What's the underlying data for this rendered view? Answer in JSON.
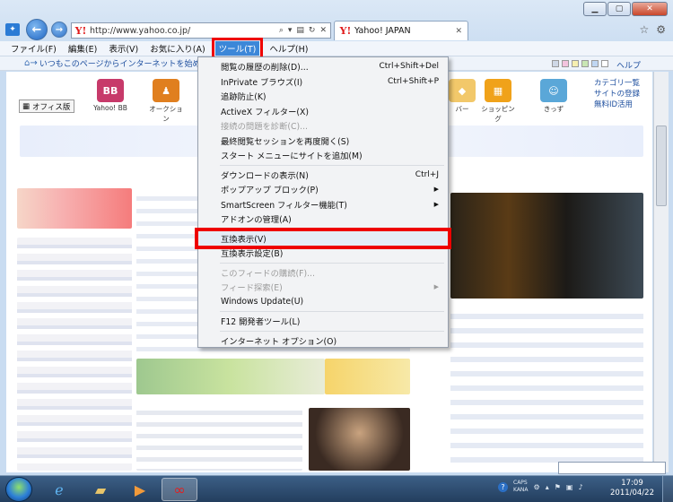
{
  "window": {
    "address": "http://www.yahoo.co.jp/",
    "tab_title": "Yahoo! JAPAN",
    "favicon_letter": "Y!"
  },
  "menubar": [
    "ファイル(F)",
    "編集(E)",
    "表示(V)",
    "お気に入り(A)",
    "ツール(T)",
    "ヘルプ(H)"
  ],
  "menubar_active_index": 4,
  "cmdbar": {
    "homepage_link": "いつもこのページからインターネットを始める",
    "help_link": "ヘルプ",
    "swatch_colors": [
      "#cfd8e6",
      "#f3c3de",
      "#f6efb0",
      "#c9e6b4",
      "#bfd6f2",
      "#ffffff"
    ]
  },
  "page": {
    "office_button": "オフィス版",
    "services": [
      {
        "label": "Yahoo! BB",
        "tile": "BB",
        "color": "#c73a6a"
      },
      {
        "label": "オークション",
        "tile": "♟",
        "color": "#e07f1f"
      },
      {
        "label": "ショッピング",
        "tile": "▦",
        "color": "#f0a21a"
      },
      {
        "label": "きっず",
        "tile": "☺",
        "color": "#5aa7d8"
      }
    ],
    "partial_service_label": "バー",
    "right_links": [
      "カテゴリ一覧",
      "サイトの登録",
      "無料ID活用"
    ]
  },
  "tools_menu": {
    "items": [
      {
        "label": "閲覧の履歴の削除(D)...",
        "shortcut": "Ctrl+Shift+Del",
        "disabled": false
      },
      {
        "label": "InPrivate ブラウズ(I)",
        "shortcut": "Ctrl+Shift+P",
        "disabled": false
      },
      {
        "label": "追跡防止(K)",
        "shortcut": "",
        "disabled": false
      },
      {
        "label": "ActiveX フィルター(X)",
        "shortcut": "",
        "disabled": false
      },
      {
        "label": "接続の問題を診断(C)...",
        "shortcut": "",
        "disabled": true
      },
      {
        "label": "最終閲覧セッションを再度開く(S)",
        "shortcut": "",
        "disabled": false
      },
      {
        "label": "スタート メニューにサイトを追加(M)",
        "shortcut": "",
        "disabled": false
      },
      {
        "sep": true
      },
      {
        "label": "ダウンロードの表示(N)",
        "shortcut": "Ctrl+J",
        "disabled": false
      },
      {
        "label": "ポップアップ ブロック(P)",
        "submenu": true,
        "disabled": false
      },
      {
        "label": "SmartScreen フィルター機能(T)",
        "submenu": true,
        "disabled": false
      },
      {
        "label": "アドオンの管理(A)",
        "shortcut": "",
        "disabled": false
      },
      {
        "sep": true
      },
      {
        "label": "互換表示(V)",
        "shortcut": "",
        "disabled": false,
        "highlight": true
      },
      {
        "label": "互換表示設定(B)",
        "shortcut": "",
        "disabled": false
      },
      {
        "sep": true
      },
      {
        "label": "このフィードの購読(F)...",
        "shortcut": "",
        "disabled": true
      },
      {
        "label": "フィード探索(E)",
        "submenu": true,
        "disabled": true
      },
      {
        "label": "Windows Update(U)",
        "shortcut": "",
        "disabled": false
      },
      {
        "sep": true
      },
      {
        "label": "F12 開発者ツール(L)",
        "shortcut": "",
        "disabled": false
      },
      {
        "sep": true
      },
      {
        "label": "インターネット オプション(O)",
        "shortcut": "",
        "disabled": false
      }
    ]
  },
  "taskbar": {
    "tray_caps": "CAPS",
    "tray_kana": "KANA",
    "time": "17:09",
    "date": "2011/04/22"
  }
}
